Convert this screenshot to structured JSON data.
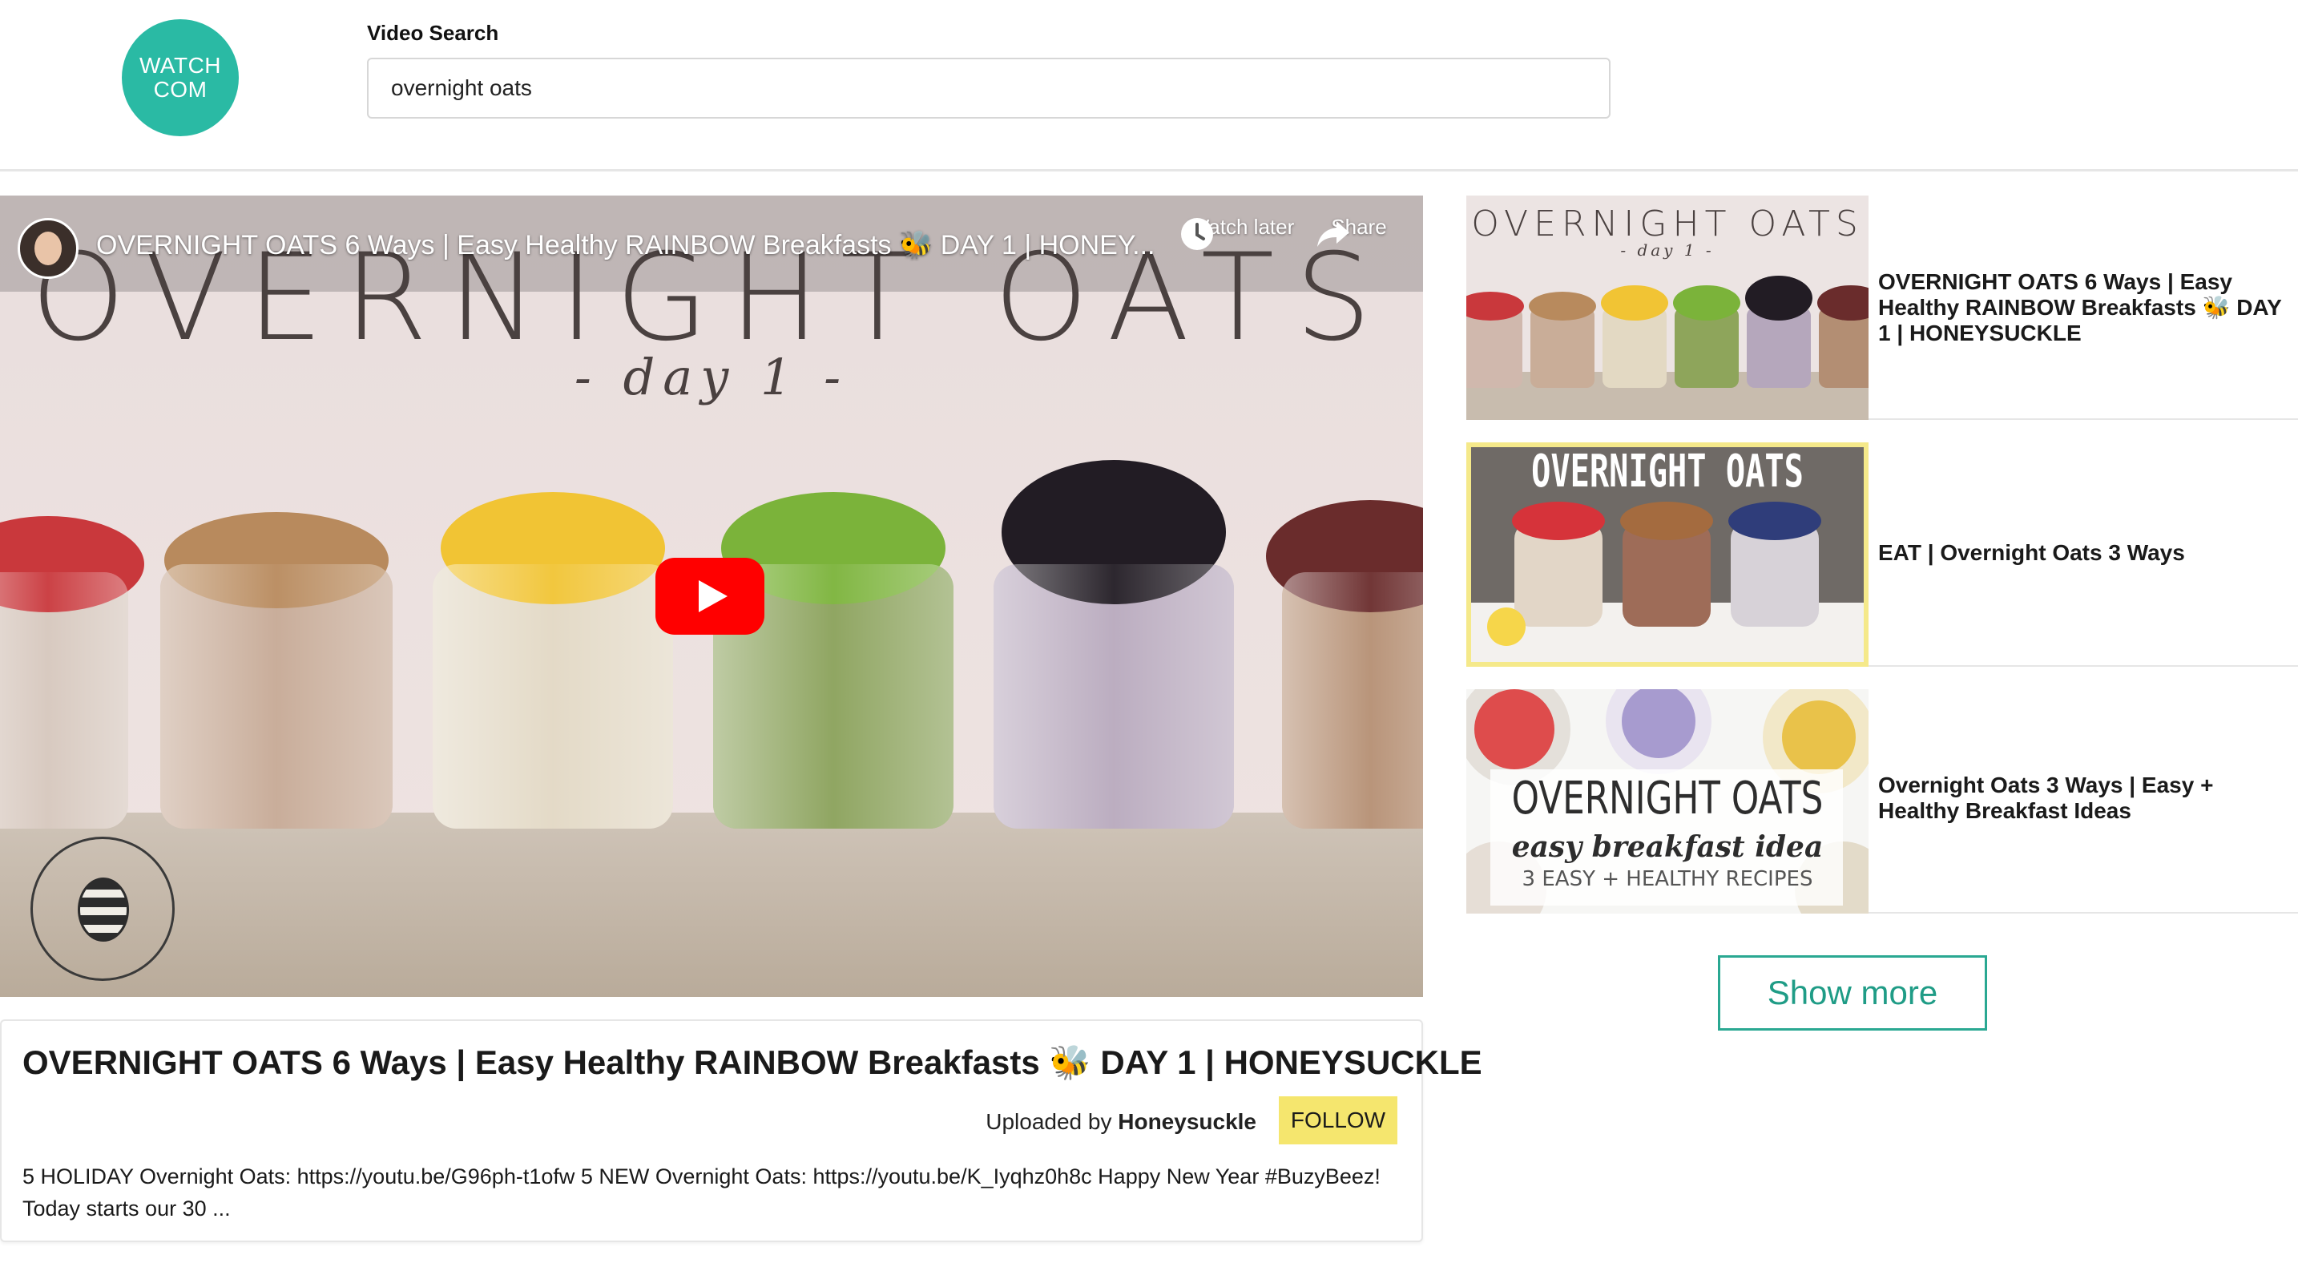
{
  "logo": {
    "line1": "WATCH",
    "line2": "COM",
    "color": "#2abaa4"
  },
  "search": {
    "label": "Video Search",
    "value": "overnight oats"
  },
  "player": {
    "overlay_title": "OVERNIGHT OATS 6 Ways | Easy Healthy RAINBOW Breakfasts 🐝 DAY 1 | HONEY...",
    "watch_later_label": "Watch later",
    "share_label": "Share",
    "thumbnail_title": "OVERNIGHT OATS",
    "thumbnail_subtitle": "- day 1 -"
  },
  "video": {
    "title": "OVERNIGHT OATS 6 Ways | Easy Healthy RAINBOW Breakfasts 🐝 DAY 1 | HONEYSUCKLE",
    "uploaded_prefix": "Uploaded by",
    "uploader": "Honeysuckle",
    "follow_label": "FOLLOW",
    "description": "5 HOLIDAY Overnight Oats: https://youtu.be/G96ph-t1ofw 5 NEW Overnight Oats: https://youtu.be/K_Iyqhz0h8c Happy New Year #BuzyBeez! Today starts our 30 ..."
  },
  "results": [
    {
      "title": "OVERNIGHT OATS 6 Ways | Easy Healthy RAINBOW Breakfasts 🐝 DAY 1 | HONEYSUCKLE",
      "thumb_text": "OVERNIGHT OATS",
      "thumb_sub": "- day 1 -"
    },
    {
      "title": "EAT | Overnight Oats 3 Ways",
      "thumb_text": "OVERNIGHT OATS"
    },
    {
      "title": "Overnight Oats 3 Ways | Easy + Healthy Breakfast Ideas",
      "thumb_text": "OVERNIGHT OATS",
      "thumb_sub": "easy breakfast idea",
      "thumb_sub2": "3 EASY + HEALTHY RECIPES"
    }
  ],
  "show_more_label": "Show more",
  "colors": {
    "accent": "#2aa892",
    "follow": "#f5e66e",
    "play": "#ff0000"
  }
}
